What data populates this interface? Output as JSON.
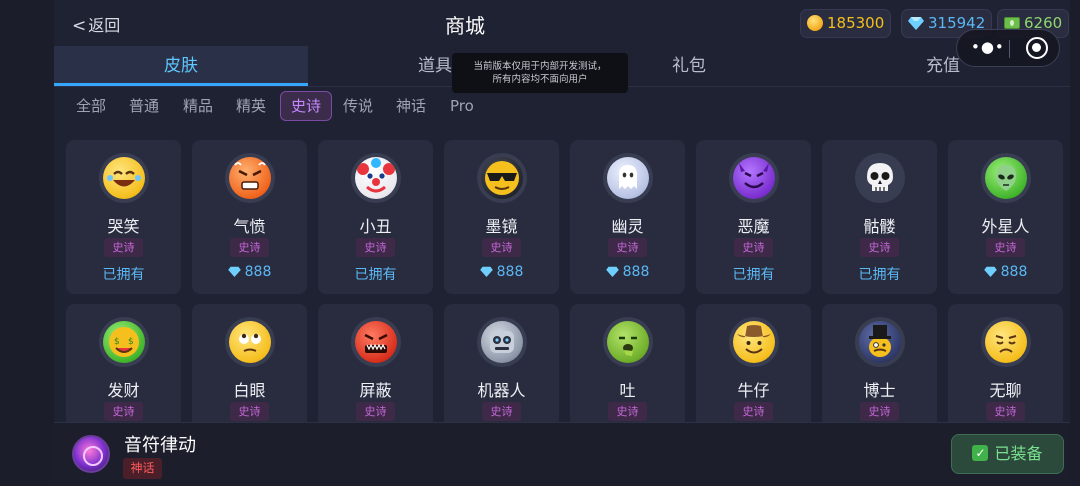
{
  "header": {
    "back_label": "返回",
    "title": "商城",
    "currencies": [
      {
        "icon": "gold-coin-icon",
        "value": "185300",
        "color": "#f5bf1e"
      },
      {
        "icon": "diamond-icon",
        "value": "315942",
        "color": "#5bb8f5"
      },
      {
        "icon": "cash-icon",
        "value": "6260",
        "color": "#6bbf4a"
      }
    ]
  },
  "tabs": [
    {
      "label": "皮肤",
      "active": true
    },
    {
      "label": "道具",
      "active": false
    },
    {
      "label": "礼包",
      "active": false
    },
    {
      "label": "充值",
      "active": false
    }
  ],
  "toast": {
    "line1": "当前版本仅用于内部开发测试，",
    "line2": "所有内容均不面向用户"
  },
  "filters": [
    {
      "label": "全部",
      "active": false
    },
    {
      "label": "普通",
      "active": false
    },
    {
      "label": "精品",
      "active": false
    },
    {
      "label": "精英",
      "active": false
    },
    {
      "label": "史诗",
      "active": true
    },
    {
      "label": "传说",
      "active": false
    },
    {
      "label": "神话",
      "active": false
    },
    {
      "label": "Pro",
      "active": false
    }
  ],
  "skins": [
    {
      "name": "哭笑",
      "tag": "史诗",
      "status": "已拥有",
      "price": "",
      "icon": "laughing-tears-icon"
    },
    {
      "name": "气愤",
      "tag": "史诗",
      "status": "",
      "price": "888",
      "icon": "angry-face-icon"
    },
    {
      "name": "小丑",
      "tag": "史诗",
      "status": "已拥有",
      "price": "",
      "icon": "clown-icon"
    },
    {
      "name": "墨镜",
      "tag": "史诗",
      "status": "",
      "price": "888",
      "icon": "sunglasses-face-icon"
    },
    {
      "name": "幽灵",
      "tag": "史诗",
      "status": "",
      "price": "888",
      "icon": "ghost-icon"
    },
    {
      "name": "恶魔",
      "tag": "史诗",
      "status": "已拥有",
      "price": "",
      "icon": "devil-icon"
    },
    {
      "name": "骷髅",
      "tag": "史诗",
      "status": "已拥有",
      "price": "",
      "icon": "skull-icon"
    },
    {
      "name": "外星人",
      "tag": "史诗",
      "status": "",
      "price": "888",
      "icon": "alien-icon"
    },
    {
      "name": "发财",
      "tag": "史诗",
      "status": "",
      "price": "",
      "icon": "money-face-icon"
    },
    {
      "name": "白眼",
      "tag": "史诗",
      "status": "",
      "price": "",
      "icon": "eye-roll-icon"
    },
    {
      "name": "屏蔽",
      "tag": "史诗",
      "status": "",
      "price": "",
      "icon": "blocked-face-icon"
    },
    {
      "name": "机器人",
      "tag": "史诗",
      "status": "",
      "price": "",
      "icon": "robot-icon"
    },
    {
      "name": "吐",
      "tag": "史诗",
      "status": "",
      "price": "",
      "icon": "vomit-face-icon"
    },
    {
      "name": "牛仔",
      "tag": "史诗",
      "status": "",
      "price": "",
      "icon": "cowboy-icon"
    },
    {
      "name": "博士",
      "tag": "史诗",
      "status": "",
      "price": "",
      "icon": "top-hat-face-icon"
    },
    {
      "name": "无聊",
      "tag": "史诗",
      "status": "",
      "price": "",
      "icon": "bored-face-icon"
    }
  ],
  "equipped": {
    "name": "音符律动",
    "tag": "神话",
    "button_label": "已装备"
  }
}
